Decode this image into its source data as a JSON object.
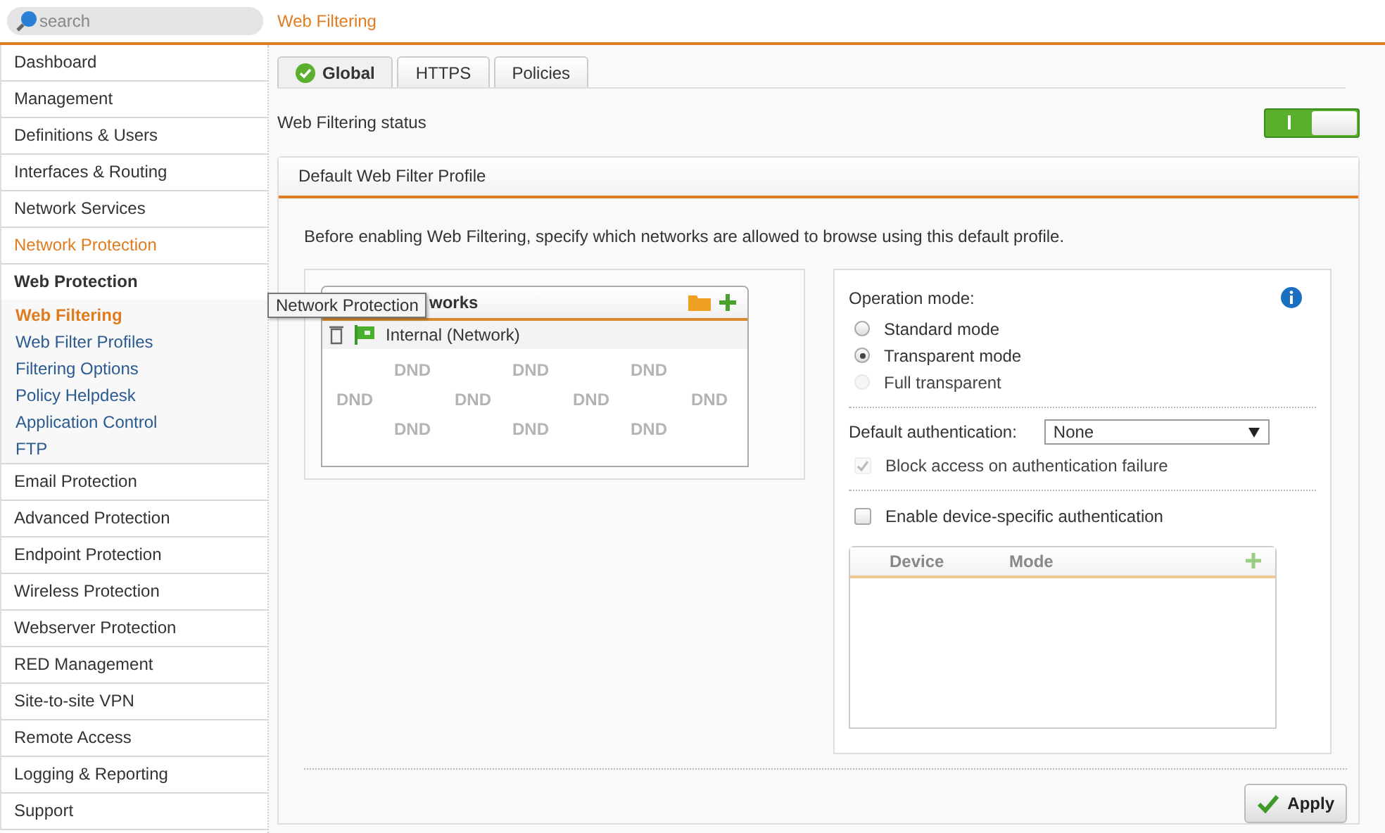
{
  "search": {
    "placeholder": "search"
  },
  "page_title": "Web Filtering",
  "sidebar": {
    "items": [
      {
        "label": "Dashboard",
        "highlighted": false,
        "expanded": false
      },
      {
        "label": "Management",
        "highlighted": false,
        "expanded": false
      },
      {
        "label": "Definitions & Users",
        "highlighted": false,
        "expanded": false
      },
      {
        "label": "Interfaces & Routing",
        "highlighted": false,
        "expanded": false
      },
      {
        "label": "Network Services",
        "highlighted": false,
        "expanded": false
      },
      {
        "label": "Network Protection",
        "highlighted": true,
        "expanded": false
      },
      {
        "label": "Web Protection",
        "highlighted": false,
        "expanded": true,
        "children": [
          {
            "label": "Web Filtering",
            "selected": true
          },
          {
            "label": "Web Filter Profiles",
            "selected": false
          },
          {
            "label": "Filtering Options",
            "selected": false
          },
          {
            "label": "Policy Helpdesk",
            "selected": false
          },
          {
            "label": "Application Control",
            "selected": false
          },
          {
            "label": "FTP",
            "selected": false
          }
        ]
      },
      {
        "label": "Email Protection",
        "highlighted": false,
        "expanded": false
      },
      {
        "label": "Advanced Protection",
        "highlighted": false,
        "expanded": false
      },
      {
        "label": "Endpoint Protection",
        "highlighted": false,
        "expanded": false
      },
      {
        "label": "Wireless Protection",
        "highlighted": false,
        "expanded": false
      },
      {
        "label": "Webserver Protection",
        "highlighted": false,
        "expanded": false
      },
      {
        "label": "RED Management",
        "highlighted": false,
        "expanded": false
      },
      {
        "label": "Site-to-site VPN",
        "highlighted": false,
        "expanded": false
      },
      {
        "label": "Remote Access",
        "highlighted": false,
        "expanded": false
      },
      {
        "label": "Logging & Reporting",
        "highlighted": false,
        "expanded": false
      },
      {
        "label": "Support",
        "highlighted": false,
        "expanded": false
      }
    ]
  },
  "tooltip": "Network Protection",
  "tabs": [
    {
      "label": "Global",
      "selected": true,
      "status_ok": true
    },
    {
      "label": "HTTPS",
      "selected": false,
      "status_ok": false
    },
    {
      "label": "Policies",
      "selected": false,
      "status_ok": false
    }
  ],
  "status": {
    "label": "Web Filtering status",
    "on": true
  },
  "profile": {
    "title": "Default Web Filter Profile",
    "description": "Before enabling Web Filtering, specify which networks are allowed to browse using this default profile.",
    "networks": {
      "header": "works",
      "items": [
        {
          "label": "Internal (Network)"
        }
      ],
      "dnd_marks": [
        "DND",
        "DND",
        "DND",
        "DND",
        "DND",
        "DND",
        "DND",
        "DND",
        "DND",
        "DND"
      ]
    },
    "operation_mode": {
      "label": "Operation mode:",
      "options": [
        {
          "label": "Standard mode",
          "selected": false,
          "disabled": false
        },
        {
          "label": "Transparent mode",
          "selected": true,
          "disabled": false
        },
        {
          "label": "Full transparent",
          "selected": false,
          "disabled": true
        }
      ]
    },
    "default_auth": {
      "label": "Default authentication:",
      "value": "None"
    },
    "block_access": {
      "label": "Block access on authentication failure",
      "checked": true,
      "disabled": true
    },
    "device_auth": {
      "label": "Enable device-specific authentication",
      "checked": false,
      "disabled": false
    },
    "device_table": {
      "columns": [
        "Device",
        "Mode"
      ]
    }
  },
  "apply_button": "Apply"
}
